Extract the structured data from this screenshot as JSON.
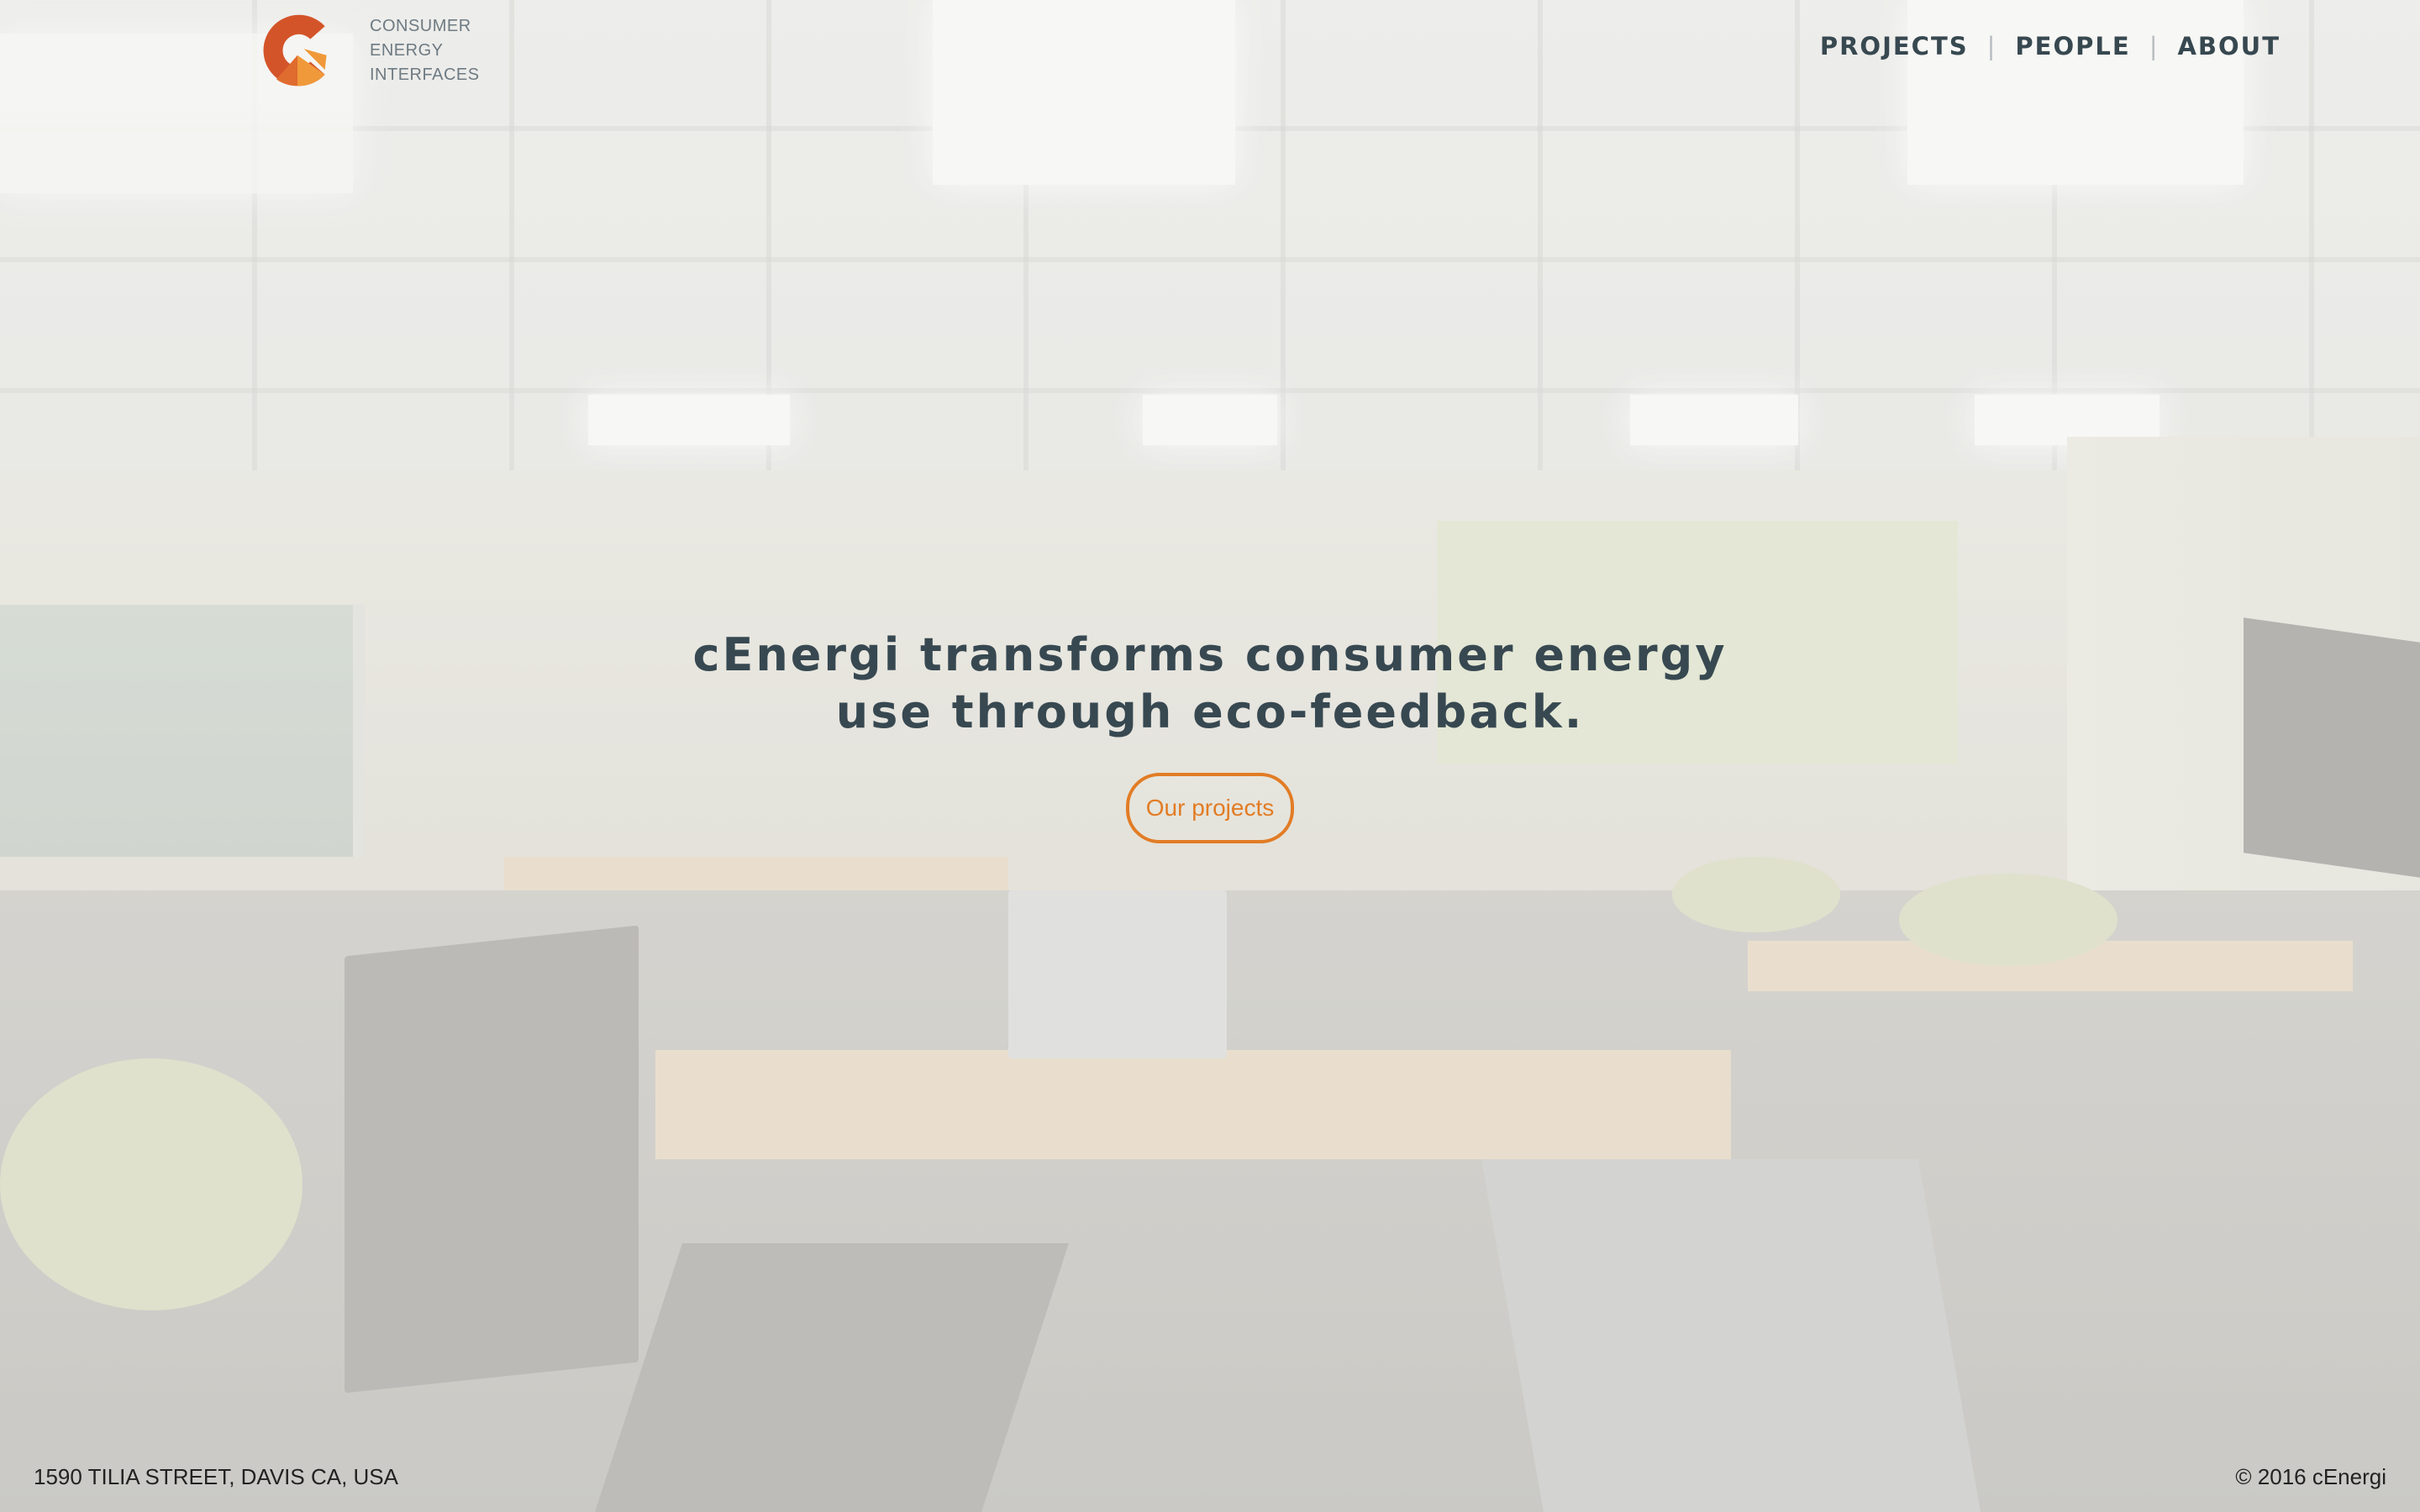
{
  "brand": {
    "logo_icon": "cenergi-c-logo-icon",
    "logo_lines": [
      "CONSUMER",
      "ENERGY",
      "INTERFACES"
    ],
    "colors": {
      "logo_dark": "#d4542a",
      "logo_light": "#f0993a"
    }
  },
  "nav": {
    "items": [
      {
        "label": "PROJECTS"
      },
      {
        "label": "PEOPLE"
      },
      {
        "label": "ABOUT"
      }
    ],
    "separator": "|"
  },
  "hero": {
    "headline_line1": "cEnergi transforms consumer energy",
    "headline_line2": "use through eco-feedback.",
    "button_label": "Our projects",
    "accent_color": "#e27c25"
  },
  "footer": {
    "address": "1590 TILIA STREET, DAVIS CA, USA",
    "copyright": "© 2016 cEnergi"
  }
}
